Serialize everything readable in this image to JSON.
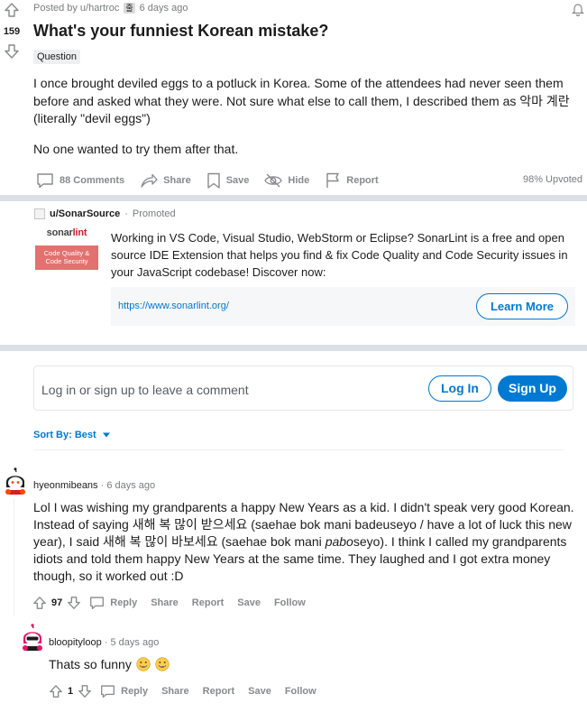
{
  "post": {
    "score": "159",
    "meta_prefix": "Posted by",
    "author": "u/hartroc",
    "author_flair": "줄",
    "time": "6 days ago",
    "title": "What's your funniest Korean mistake?",
    "flair": "Question",
    "body_1": "I once brought deviled eggs to a potluck in Korea. Some of the attendees had never seen them before and asked what they were. Not sure what else to call them, I described them as 악마 계란 (literally \"devil eggs\")",
    "body_2": "No one wanted to try them after that.",
    "actions": {
      "comments": "88 Comments",
      "share": "Share",
      "save": "Save",
      "hide": "Hide",
      "report": "Report"
    },
    "upvoted": "98% Upvoted"
  },
  "promoted": {
    "user": "u/SonarSource",
    "label": "Promoted",
    "logo_word_a": "sonar",
    "logo_word_b": "lint",
    "logo_badge": "Code Quality & Code Security",
    "text": "Working in VS Code, Visual Studio, WebStorm or Eclipse? SonarLint is a free and open source IDE Extension that helps you find & fix Code Quality and Code Security issues in your JavaScript codebase! Discover now:",
    "url": "https://www.sonarlint.org/",
    "cta": "Learn More"
  },
  "comment_box": {
    "placeholder": "Log in or sign up to leave a comment",
    "login": "Log In",
    "signup": "Sign Up"
  },
  "sort": {
    "label": "Sort By: Best"
  },
  "comments": [
    {
      "author": "hyeonmibeans",
      "time": "· 6 days ago",
      "body_a": "Lol I was wishing my grandparents a happy New Years as a kid. I didn't speak very good Korean. Instead of saying 새해 복 많이 받으세요 (saehae bok mani badeuseyo / have a lot of luck this new year), I said 새해 복 많이 바보세요 (saehae bok mani ",
      "body_italic": "pabo",
      "body_b": "seyo). I think I called my grandparents idiots and told them happy New Years at the same time. They laughed and I got extra money though, so it worked out :D",
      "score": "97",
      "reply": "Reply",
      "share": "Share",
      "report": "Report",
      "save": "Save",
      "follow": "Follow"
    },
    {
      "author": "bloopityloop",
      "time": "· 5 days ago",
      "body": "Thats so funny",
      "score": "1",
      "reply": "Reply",
      "share": "Share",
      "report": "Report",
      "save": "Save",
      "follow": "Follow"
    }
  ]
}
